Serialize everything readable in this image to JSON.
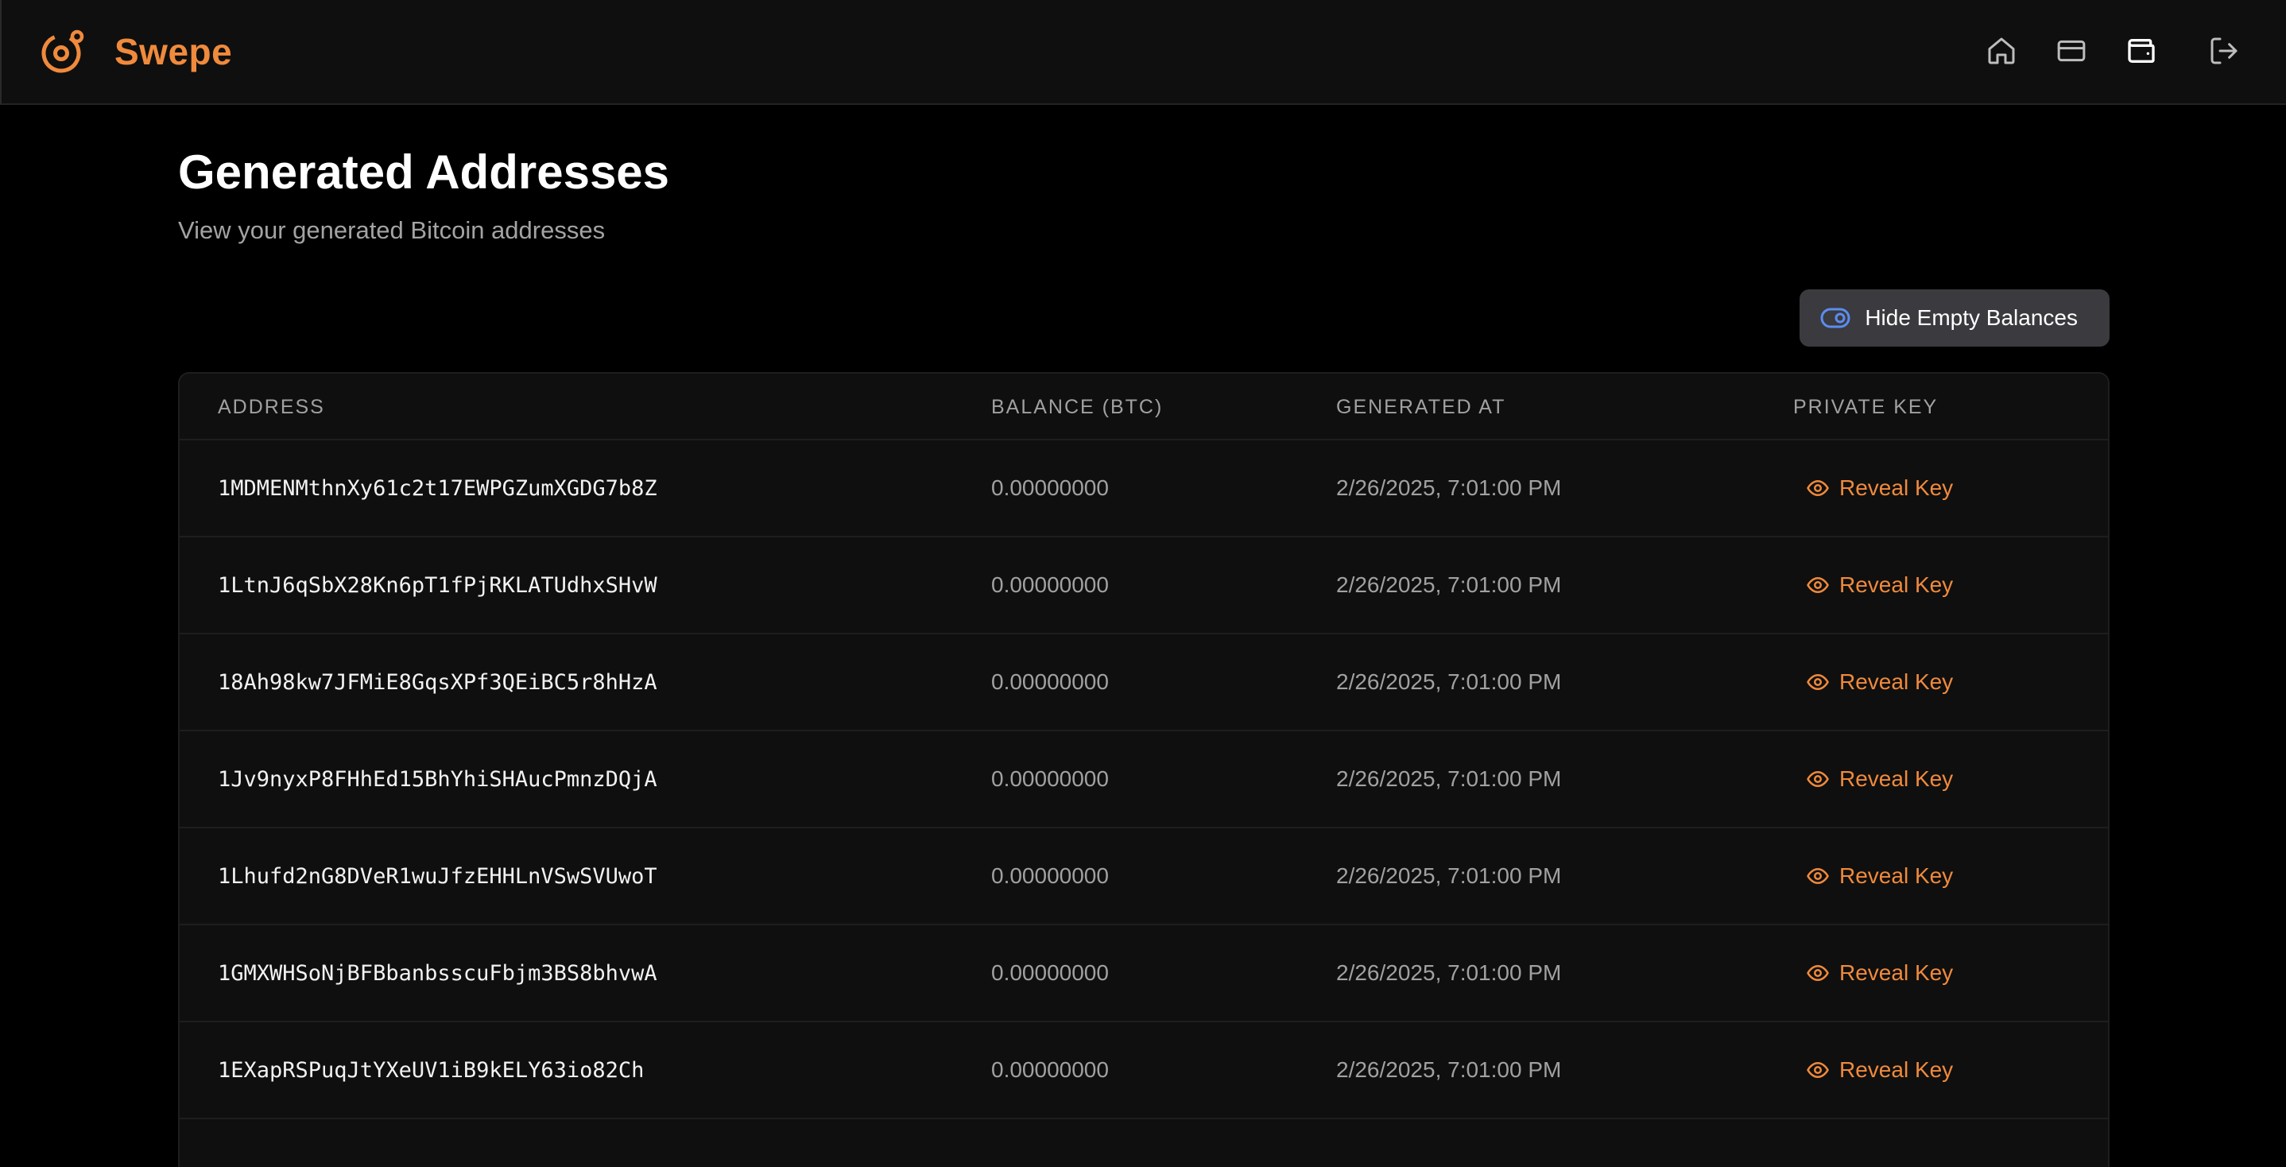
{
  "app": {
    "name": "Swepe",
    "accent": "#f08a3c"
  },
  "nav": [
    {
      "icon": "home-icon"
    },
    {
      "icon": "credit-card-icon"
    },
    {
      "icon": "wallet-icon"
    },
    {
      "icon": "logout-icon"
    }
  ],
  "page": {
    "title": "Generated Addresses",
    "subtitle": "View your generated Bitcoin addresses",
    "toggle_label": "Hide Empty Balances"
  },
  "table": {
    "headers": {
      "address": "ADDRESS",
      "balance": "BALANCE (BTC)",
      "generated_at": "GENERATED AT",
      "private_key": "PRIVATE KEY"
    },
    "reveal_label": "Reveal Key",
    "rows": [
      {
        "address": "1MDMENMthnXy61c2t17EWPGZumXGDG7b8Z",
        "balance": "0.00000000",
        "generated_at": "2/26/2025, 7:01:00 PM"
      },
      {
        "address": "1LtnJ6qSbX28Kn6pT1fPjRKLATUdhxSHvW",
        "balance": "0.00000000",
        "generated_at": "2/26/2025, 7:01:00 PM"
      },
      {
        "address": "18Ah98kw7JFMiE8GqsXPf3QEiBC5r8hHzA",
        "balance": "0.00000000",
        "generated_at": "2/26/2025, 7:01:00 PM"
      },
      {
        "address": "1Jv9nyxP8FHhEd15BhYhiSHAucPmnzDQjA",
        "balance": "0.00000000",
        "generated_at": "2/26/2025, 7:01:00 PM"
      },
      {
        "address": "1Lhufd2nG8DVeR1wuJfzEHHLnVSwSVUwoT",
        "balance": "0.00000000",
        "generated_at": "2/26/2025, 7:01:00 PM"
      },
      {
        "address": "1GMXWHSoNjBFBbanbsscuFbjm3BS8bhvwA",
        "balance": "0.00000000",
        "generated_at": "2/26/2025, 7:01:00 PM"
      },
      {
        "address": "1EXapRSPuqJtYXeUV1iB9kELY63io82Ch",
        "balance": "0.00000000",
        "generated_at": "2/26/2025, 7:01:00 PM"
      }
    ]
  }
}
